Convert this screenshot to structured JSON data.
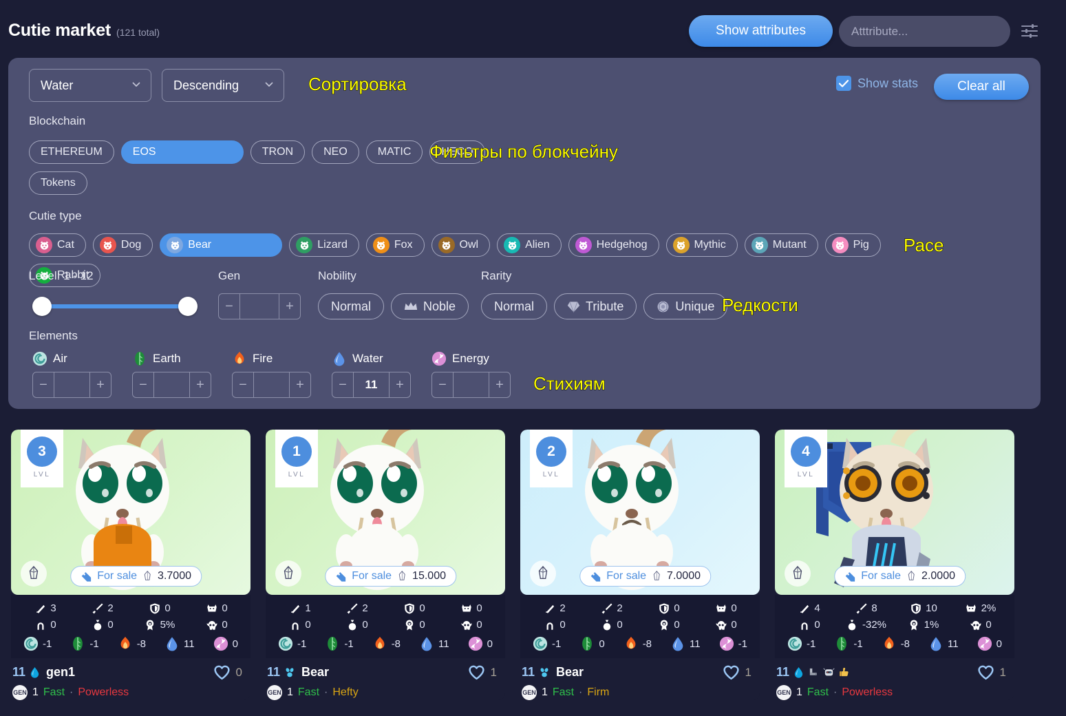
{
  "header": {
    "title": "Cutie market",
    "count": "(121 total)",
    "show_attributes_label": "Show attributes",
    "attribute_placeholder": "Atttribute...",
    "sliders_icon": "sliders-icon"
  },
  "filters": {
    "sort_field": "Water",
    "sort_direction": "Descending",
    "show_stats_label": "Show stats",
    "show_stats_checked": true,
    "clear_all_label": "Clear all",
    "blockchain_label": "Blockchain",
    "blockchain_chips": [
      {
        "label": "ETHEREUM",
        "selected": false
      },
      {
        "label": "EOS",
        "selected": true
      },
      {
        "label": "TRON",
        "selected": false
      },
      {
        "label": "NEO",
        "selected": false
      },
      {
        "label": "MATIC",
        "selected": false
      },
      {
        "label": "HECO",
        "selected": false
      }
    ],
    "tokens_label": "Tokens",
    "cutie_type_label": "Cutie type",
    "cutie_types": [
      {
        "label": "Cat",
        "selected": false,
        "color": "#d95f8f",
        "icon": "cat-icon"
      },
      {
        "label": "Dog",
        "selected": false,
        "color": "#e8554e",
        "icon": "dog-icon"
      },
      {
        "label": "Bear",
        "selected": true,
        "color": "#7fa8e0",
        "icon": "bear-icon"
      },
      {
        "label": "Lizard",
        "selected": false,
        "color": "#2f9e63",
        "icon": "lizard-icon"
      },
      {
        "label": "Fox",
        "selected": false,
        "color": "#ef8f17",
        "icon": "fox-icon"
      },
      {
        "label": "Owl",
        "selected": false,
        "color": "#9a6a27",
        "icon": "owl-icon"
      },
      {
        "label": "Alien",
        "selected": false,
        "color": "#18b9b3",
        "icon": "alien-icon"
      },
      {
        "label": "Hedgehog",
        "selected": false,
        "color": "#bf5ad4",
        "icon": "hedgehog-icon"
      },
      {
        "label": "Mythic",
        "selected": false,
        "color": "#dba22b",
        "icon": "mythic-icon"
      },
      {
        "label": "Mutant",
        "selected": false,
        "color": "#5ca6b8",
        "icon": "mutant-icon"
      },
      {
        "label": "Pig",
        "selected": false,
        "color": "#f58dc0",
        "icon": "pig-icon"
      },
      {
        "label": "Rabbit",
        "selected": false,
        "color": "#15af3f",
        "icon": "rabbit-icon"
      }
    ],
    "level_label": "Level: 1 - 12",
    "gen_label": "Gen",
    "gen_value": "",
    "nobility_label": "Nobility",
    "nobility_chips": [
      {
        "label": "Normal",
        "icon": ""
      },
      {
        "label": "Noble",
        "icon": "crown-icon"
      }
    ],
    "rarity_label": "Rarity",
    "rarity_chips": [
      {
        "label": "Normal",
        "icon": ""
      },
      {
        "label": "Tribute",
        "icon": "gem-icon"
      },
      {
        "label": "Unique",
        "icon": "unique-gem-icon"
      }
    ],
    "elements_label": "Elements",
    "elements": [
      {
        "name": "Air",
        "value": "",
        "color": "#b8e4e0",
        "glyph": "◌",
        "icon": "air-icon"
      },
      {
        "name": "Earth",
        "value": "",
        "color": "#1d8a3a",
        "glyph": "❦",
        "icon": "earth-icon"
      },
      {
        "name": "Fire",
        "value": "",
        "color": "#f06020",
        "glyph": "▲",
        "icon": "fire-icon"
      },
      {
        "name": "Water",
        "value": "11",
        "color": "#4d8ede",
        "glyph": "●",
        "icon": "water-icon"
      },
      {
        "name": "Energy",
        "value": "",
        "color": "#dd8fd6",
        "glyph": "✽",
        "icon": "energy-icon"
      }
    ]
  },
  "annotations": {
    "sorting": "Сортировка",
    "blockchain": "Фильтры по блокчейну",
    "race": "Расе",
    "rarity": "Редкости",
    "elements": "Стихиям"
  },
  "card_labels": {
    "lvl": "LVL",
    "for_sale": "For sale",
    "gen_badge": "GEN"
  },
  "cards": [
    {
      "level": "3",
      "bg": "green",
      "price": "3.7000",
      "chain": "EOS",
      "variant": "orange-shirt",
      "stats_row1": [
        "3",
        "2",
        "0",
        "0"
      ],
      "stats_row2": [
        "0",
        "0",
        "5%",
        "0"
      ],
      "elements": [
        "-1",
        "-1",
        "-8",
        "11",
        "0"
      ],
      "power": "11",
      "name": "gen1",
      "name_icons": [
        "water-drop-icon"
      ],
      "likes": "0",
      "gen": "1",
      "trait1": "Fast",
      "trait1_color": "#2fbf4a",
      "trait2": "Powerless",
      "trait2_color": "#e8383f"
    },
    {
      "level": "1",
      "bg": "green",
      "price": "15.000",
      "chain": "EOS",
      "variant": "plain",
      "stats_row1": [
        "1",
        "2",
        "0",
        "0"
      ],
      "stats_row2": [
        "0",
        "0",
        "0",
        "0"
      ],
      "elements": [
        "-1",
        "-1",
        "-8",
        "11",
        "0"
      ],
      "power": "11",
      "name": "Bear",
      "name_icons": [
        "bear-paw-icon"
      ],
      "likes": "1",
      "gen": "1",
      "trait1": "Fast",
      "trait1_color": "#2fbf4a",
      "trait2": "Hefty",
      "trait2_color": "#d9a513"
    },
    {
      "level": "2",
      "bg": "blue",
      "price": "7.0000",
      "chain": "EOS",
      "variant": "plain-frown",
      "stats_row1": [
        "2",
        "2",
        "0",
        "0"
      ],
      "stats_row2": [
        "0",
        "0",
        "0",
        "0"
      ],
      "elements": [
        "-1",
        "0",
        "-8",
        "11",
        "-1"
      ],
      "power": "11",
      "name": "Bear",
      "name_icons": [
        "bear-paw-icon"
      ],
      "likes": "1",
      "gen": "1",
      "trait1": "Fast",
      "trait1_color": "#2fbf4a",
      "trait2": "Firm",
      "trait2_color": "#d9a513"
    },
    {
      "level": "4",
      "bg": "mint",
      "price": "2.0000",
      "chain": "EOS",
      "variant": "cyborg",
      "stats_row1": [
        "4",
        "8",
        "10",
        "2%"
      ],
      "stats_row2": [
        "0",
        "-32%",
        "1%",
        "0"
      ],
      "elements": [
        "-1",
        "-1",
        "-8",
        "11",
        "0"
      ],
      "power": "11",
      "name": "",
      "name_icons": [
        "water-drop-icon",
        "mechanical-arm-icon",
        "robot-icon",
        "thumbs-up-icon"
      ],
      "likes": "1",
      "gen": "1",
      "trait1": "Fast",
      "trait1_color": "#2fbf4a",
      "trait2": "Powerless",
      "trait2_color": "#e8383f"
    }
  ],
  "stat_icons": [
    "banner-icon",
    "sword-icon",
    "shield-icon",
    "beast-icon",
    "horseshoe-icon",
    "moneybag-icon",
    "medal-icon",
    "skull-icon"
  ],
  "element_icons": [
    "air-icon",
    "earth-icon",
    "fire-icon",
    "water-icon",
    "energy-icon"
  ]
}
